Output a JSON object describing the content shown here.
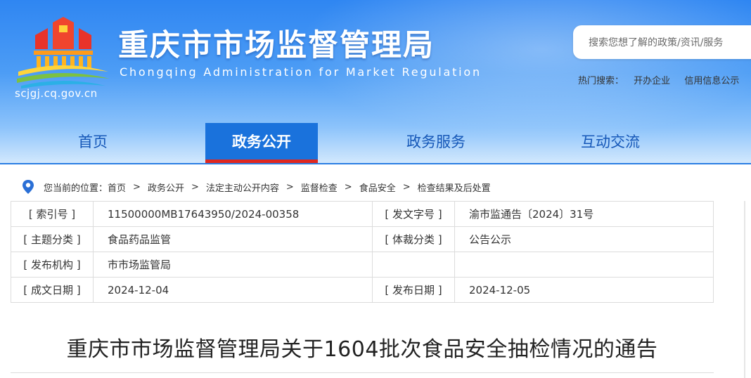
{
  "header": {
    "title": "重庆市市场监督管理局",
    "subtitle": "Chongqing  Administration for Market Regulation",
    "domain": "scjgj.cq.gov.cn"
  },
  "search": {
    "placeholder": "搜索您想了解的政策/资讯/服务",
    "hot_label": "热门搜索：",
    "hot_links": [
      "开办企业",
      "信用信息公示"
    ]
  },
  "nav": {
    "items": [
      {
        "label": "首页",
        "active": false
      },
      {
        "label": "政务公开",
        "active": true
      },
      {
        "label": "政务服务",
        "active": false
      },
      {
        "label": "互动交流",
        "active": false
      }
    ]
  },
  "breadcrumb": {
    "prefix": "您当前的位置：",
    "items": [
      "首页",
      "政务公开",
      "法定主动公开内容",
      "监督检查",
      "食品安全",
      "检查结果及后处置"
    ],
    "separator": ">"
  },
  "info": {
    "rows": [
      {
        "label1": "[ 索引号 ]",
        "value1": "11500000MB17643950/2024-00358",
        "label2": "[ 发文字号 ]",
        "value2": "渝市监通告〔2024〕31号"
      },
      {
        "label1": "[ 主题分类 ]",
        "value1": "食品药品监管",
        "label2": "[ 体裁分类 ]",
        "value2": "公告公示"
      },
      {
        "label1": "[ 发布机构 ]",
        "value1": "市市场监管局",
        "label2": "",
        "value2": ""
      },
      {
        "label1": "[ 成文日期 ]",
        "value1": "2024-12-04",
        "label2": "[ 发布日期 ]",
        "value2": "2024-12-05"
      }
    ]
  },
  "article": {
    "title": "重庆市市场监督管理局关于1604批次食品安全抽检情况的通告"
  },
  "colors": {
    "header_top": "#2f86f2",
    "nav_active_bg": "#1a72dc",
    "nav_active_underline": "#e0281f",
    "nav_text": "#1557b8",
    "pin": "#2a6fd6"
  },
  "icons": [
    "government-emblem-logo",
    "location-pin-icon"
  ]
}
